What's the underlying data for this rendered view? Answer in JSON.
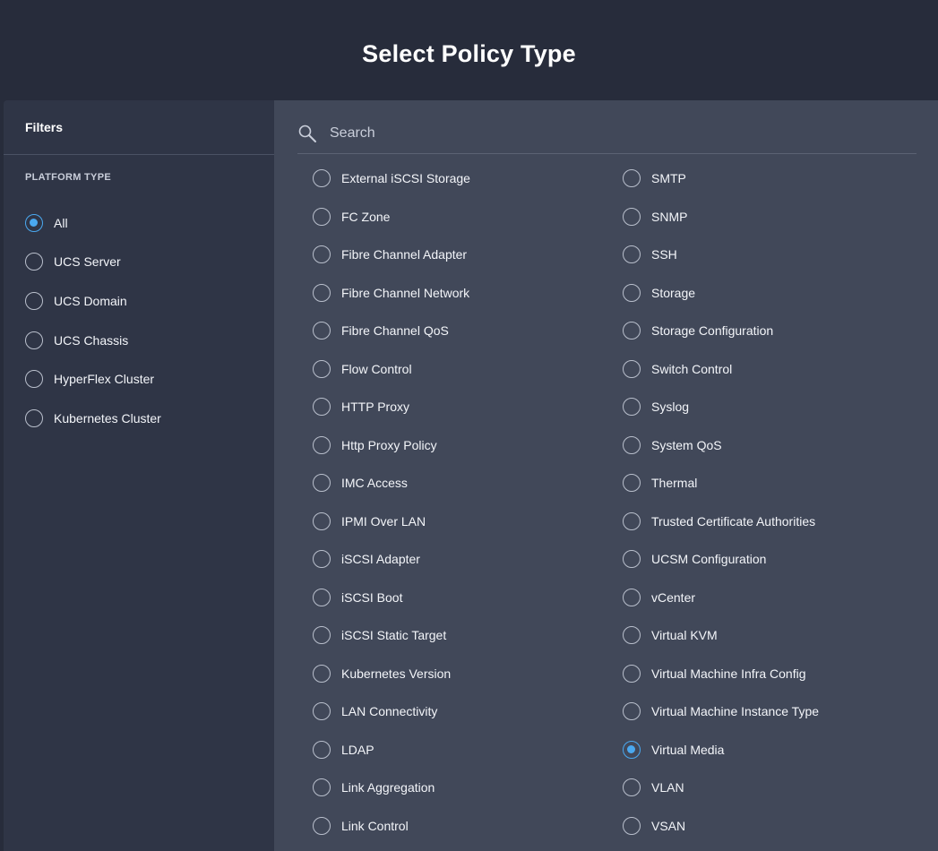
{
  "page": {
    "title": "Select Policy Type"
  },
  "filters": {
    "title": "Filters",
    "platform_type_label": "PLATFORM TYPE",
    "items": [
      {
        "label": "All",
        "checked": true
      },
      {
        "label": "UCS Server",
        "checked": false
      },
      {
        "label": "UCS Domain",
        "checked": false
      },
      {
        "label": "UCS Chassis",
        "checked": false
      },
      {
        "label": "HyperFlex Cluster",
        "checked": false
      },
      {
        "label": "Kubernetes Cluster",
        "checked": false
      }
    ]
  },
  "search": {
    "placeholder": "Search",
    "value": ""
  },
  "policies": {
    "left": [
      "External iSCSI Storage",
      "FC Zone",
      "Fibre Channel Adapter",
      "Fibre Channel Network",
      "Fibre Channel QoS",
      "Flow Control",
      "HTTP Proxy",
      "Http Proxy Policy",
      "IMC Access",
      "IPMI Over LAN",
      "iSCSI Adapter",
      "iSCSI Boot",
      "iSCSI Static Target",
      "Kubernetes Version",
      "LAN Connectivity",
      "LDAP",
      "Link Aggregation",
      "Link Control"
    ],
    "right": [
      "SMTP",
      "SNMP",
      "SSH",
      "Storage",
      "Storage Configuration",
      "Switch Control",
      "Syslog",
      "System QoS",
      "Thermal",
      "Trusted Certificate Authorities",
      "UCSM Configuration",
      "vCenter",
      "Virtual KVM",
      "Virtual Machine Infra Config",
      "Virtual Machine Instance Type",
      "Virtual Media",
      "VLAN",
      "VSAN"
    ],
    "selected": "Virtual Media"
  },
  "colors": {
    "accent": "#4aa8ef",
    "header_bg": "#272c3b",
    "sidebar_bg": "#2f3546",
    "main_bg": "#414859"
  }
}
